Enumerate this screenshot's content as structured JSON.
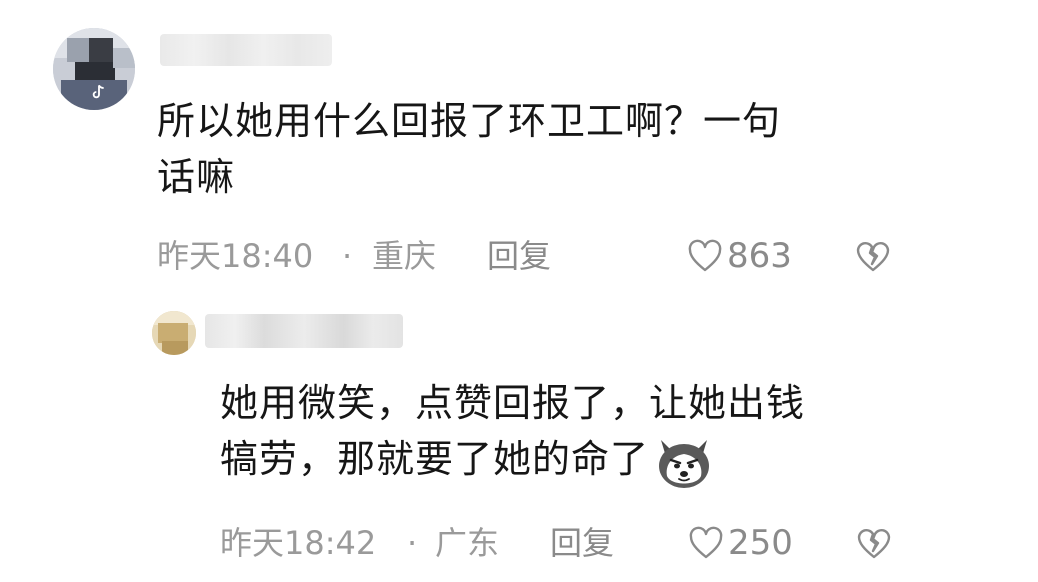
{
  "comments": [
    {
      "text_line1": "所以她用什么回报了环卫工啊？一句",
      "text_line2": "话嘛",
      "time": "昨天18:40",
      "separator": "·",
      "location": "重庆",
      "reply_label": "回复",
      "likes": "863"
    },
    {
      "text_line1": "她用微笑，点赞回报了，让她出钱",
      "text_line2": "犒劳，那就要了她的命了",
      "emoji": "husky-emoji",
      "time": "昨天18:42",
      "separator": "·",
      "location": "广东",
      "reply_label": "回复",
      "likes": "250"
    }
  ],
  "icons": {
    "like": "heart-outline-icon",
    "dislike": "broken-heart-icon",
    "platform_badge": "tiktok-icon"
  },
  "colors": {
    "text": "#161616",
    "meta": "#9a9a9a",
    "background": "#ffffff"
  }
}
